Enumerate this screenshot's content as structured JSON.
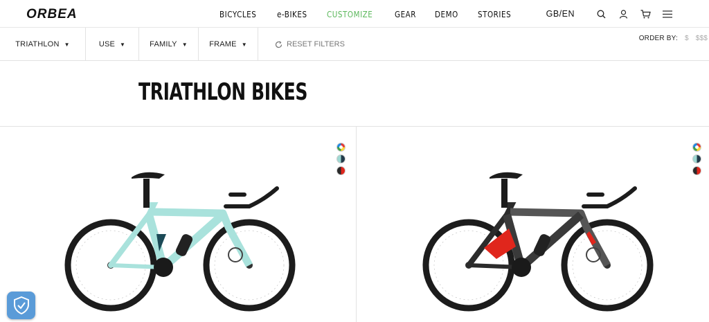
{
  "brand": {
    "logo_text": "ORBEA"
  },
  "nav": {
    "links": [
      {
        "label": "BICYCLES"
      },
      {
        "label": "e-BIKES"
      },
      {
        "label": "CUSTOMIZE"
      },
      {
        "label": "GEAR"
      },
      {
        "label": "DEMO"
      },
      {
        "label": "STORIES"
      }
    ],
    "accent_color": "#5cb85c",
    "lang": "GB/EN",
    "icons": [
      "search-icon",
      "user-icon",
      "cart-icon",
      "menu-icon"
    ]
  },
  "filters": {
    "items": [
      {
        "label": "TRIATHLON"
      },
      {
        "label": "USE"
      },
      {
        "label": "FAMILY"
      },
      {
        "label": "FRAME"
      }
    ],
    "reset_label": "RESET FILTERS",
    "order_by_label": "ORDER BY:",
    "order_options": [
      "$",
      "$$$"
    ]
  },
  "page": {
    "title": "TRIATHLON BIKES"
  },
  "products": [
    {
      "frame_color": "#a9e2dc",
      "swatches": [
        "multicolor",
        "mint-navy",
        "black-red"
      ]
    },
    {
      "frame_color": "#2b2b2b",
      "swatches": [
        "multicolor",
        "mint-navy",
        "black-red"
      ]
    }
  ]
}
